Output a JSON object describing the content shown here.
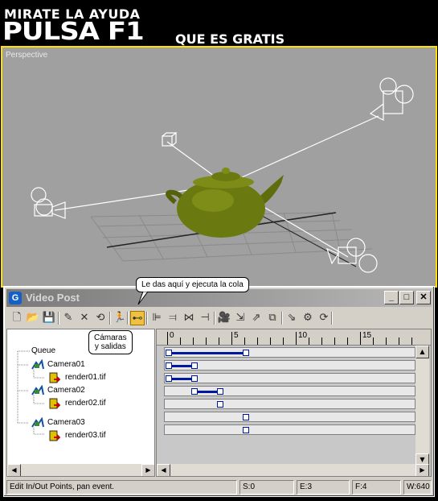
{
  "header": {
    "line1": "MIRATE LA AYUDA",
    "line2": "PULSA F1",
    "line3": "QUE ES GRATIS"
  },
  "viewport": {
    "label": "Perspective",
    "background": "#a0a0a0",
    "border_color": "#ffe000",
    "object_color": "#6b7a10"
  },
  "window": {
    "title": "Video Post",
    "icon_letter": "G",
    "buttons": {
      "minimize": "_",
      "maximize": "□",
      "close": "✕"
    }
  },
  "toolbar": {
    "tools": [
      {
        "name": "new-icon",
        "glyph": "🗋"
      },
      {
        "name": "open-icon",
        "glyph": "📂"
      },
      {
        "name": "save-icon",
        "glyph": "💾"
      },
      {
        "name": "edit-event-icon",
        "glyph": "✎"
      },
      {
        "name": "delete-icon",
        "glyph": "✕"
      },
      {
        "name": "swap-icon",
        "glyph": "⟲"
      },
      {
        "name": "execute-sequence-icon",
        "glyph": "🏃"
      },
      {
        "name": "edit-range-bar-icon",
        "glyph": "⊷"
      },
      {
        "name": "align-left-icon",
        "glyph": "⊫"
      },
      {
        "name": "align-right-icon",
        "glyph": "⫤"
      },
      {
        "name": "make-same-size-icon",
        "glyph": "⋈"
      },
      {
        "name": "abut-icon",
        "glyph": "⊣"
      },
      {
        "name": "add-scene-event-icon",
        "glyph": "🎥"
      },
      {
        "name": "add-image-input-icon",
        "glyph": "⇲"
      },
      {
        "name": "add-image-filter-icon",
        "glyph": "⇗"
      },
      {
        "name": "add-image-layer-icon",
        "glyph": "⧉"
      },
      {
        "name": "add-image-output-icon",
        "glyph": "⇘"
      },
      {
        "name": "add-external-event-icon",
        "glyph": "⚙"
      },
      {
        "name": "add-loop-event-icon",
        "glyph": "⟳"
      }
    ]
  },
  "tree": {
    "items": [
      {
        "label": "Queue",
        "kind": "queue"
      },
      {
        "label": "Camera01",
        "kind": "camera"
      },
      {
        "label": "render01.tif",
        "kind": "output"
      },
      {
        "label": "Camera02",
        "kind": "camera"
      },
      {
        "label": "render02.tif",
        "kind": "output"
      },
      {
        "label": "Camera03",
        "kind": "camera"
      },
      {
        "label": "render03.tif",
        "kind": "output"
      }
    ]
  },
  "timeline": {
    "ruler_labels": [
      "0",
      "5",
      "10",
      "15"
    ],
    "frames_visible": [
      0,
      19
    ],
    "rows": [
      {
        "start": 0,
        "end": 6
      },
      {
        "start": 0,
        "end": 2
      },
      {
        "start": 0,
        "end": 2
      },
      {
        "start": 2,
        "end": 4
      },
      {
        "start": 4,
        "end": 4
      },
      {
        "start": 6,
        "end": 6
      },
      {
        "start": 6,
        "end": 6
      }
    ]
  },
  "status": {
    "message": "Edit In/Out Points, pan event.",
    "start": "S:0",
    "end": "E:3",
    "frames": "F:4",
    "width": "W:640"
  },
  "callouts": {
    "execute": "Le das aquí y ejecuta la cola",
    "cameras_line1": "Cámaras",
    "cameras_line2": "y salidas"
  }
}
